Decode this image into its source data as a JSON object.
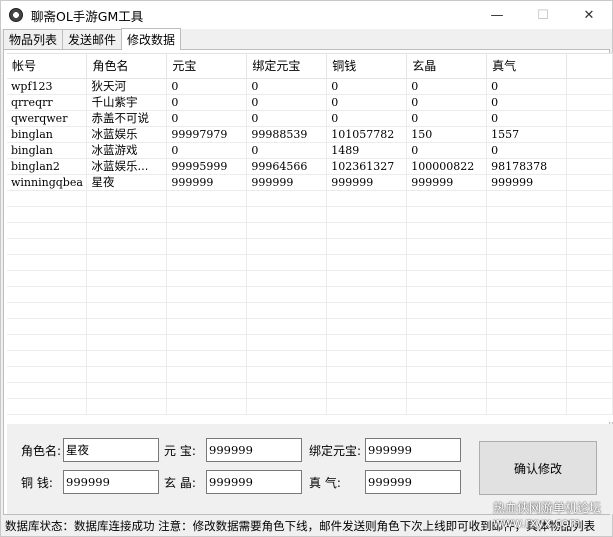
{
  "window": {
    "title": "聊斋OL手游GM工具",
    "minimize": "—",
    "maximize": "☐",
    "close": "✕"
  },
  "tabs": [
    {
      "label": "物品列表",
      "active": false
    },
    {
      "label": "发送邮件",
      "active": false
    },
    {
      "label": "修改数据",
      "active": true
    }
  ],
  "table": {
    "columns": [
      "帐号",
      "角色名",
      "元宝",
      "绑定元宝",
      "铜钱",
      "玄晶",
      "真气"
    ],
    "rows": [
      [
        "wpf123",
        "狄天河",
        "0",
        "0",
        "0",
        "0",
        "0"
      ],
      [
        "qrreqrr",
        "千山紫宇",
        "0",
        "0",
        "0",
        "0",
        "0"
      ],
      [
        "qwerqwer",
        "赤盖不可说",
        "0",
        "0",
        "0",
        "0",
        "0"
      ],
      [
        "binglan",
        "冰蓝娱乐",
        "99997979",
        "99988539",
        "101057782",
        "150",
        "1557"
      ],
      [
        "binglan",
        "冰蓝游戏",
        "0",
        "0",
        "1489",
        "0",
        "0"
      ],
      [
        "binglan2",
        "冰蓝娱乐...",
        "99995999",
        "99964566",
        "102361327",
        "100000822",
        "98178378"
      ],
      [
        "winningqbea",
        "星夜",
        "999999",
        "999999",
        "999999",
        "999999",
        "999999"
      ]
    ]
  },
  "edit": {
    "role_name_label": "角色名:",
    "role_name_value": "星夜",
    "yuanbao_label": "元  宝:",
    "yuanbao_value": "999999",
    "bound_yuanbao_label": "绑定元宝:",
    "bound_yuanbao_value": "999999",
    "copper_label": "铜  钱:",
    "copper_value": "999999",
    "xuanjing_label": "玄  晶:",
    "xuanjing_value": "999999",
    "zhenqi_label": "真    气:",
    "zhenqi_value": "999999",
    "confirm_label": "确认修改"
  },
  "status": {
    "text": "数据库状态：数据库连接成功  注意：修改数据需要角色下线，邮件发送则角色下次上线即可收到邮件，具体物品列表"
  },
  "watermark": {
    "line1": "热血侠网游单机论坛",
    "line2": "www.rxyx.com"
  }
}
